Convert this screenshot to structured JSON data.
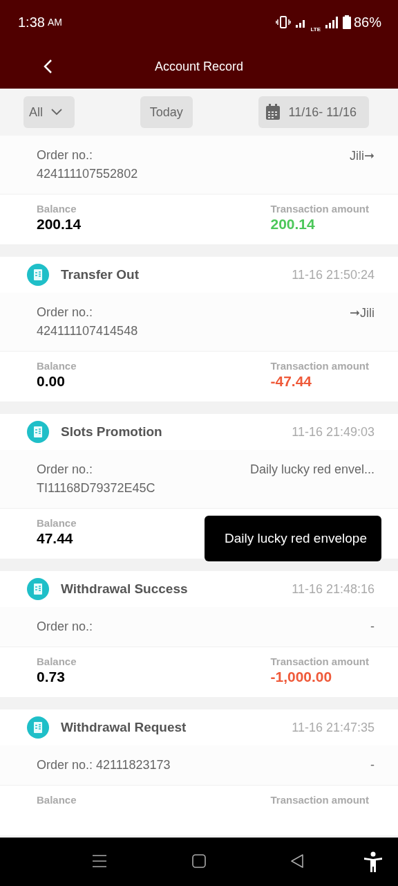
{
  "status_bar": {
    "time": "1:38",
    "meridiem": "AM",
    "network": "LTE",
    "battery": "86%"
  },
  "header": {
    "title": "Account Record"
  },
  "filters": {
    "type": "All",
    "period": "Today",
    "date_range": "11/16- 11/16"
  },
  "records": [
    {
      "order_label": "Order no.:",
      "order_number": "424111107552802",
      "target": "Jili➞",
      "balance_label": "Balance",
      "balance": "200.14",
      "amount_label": "Transaction amount",
      "amount": "200.14",
      "kind": "credit"
    },
    {
      "title": "Transfer Out",
      "time": "11-16 21:50:24",
      "order_label": "Order no.:",
      "order_number": "424111107414548",
      "target": "➞Jili",
      "balance_label": "Balance",
      "balance": "0.00",
      "amount_label": "Transaction amount",
      "amount": "-47.44",
      "kind": "debit"
    },
    {
      "title": "Slots Promotion",
      "time": "11-16 21:49:03",
      "order_label": "Order no.:",
      "order_number": "TI11168D79372E45C",
      "target": "Daily lucky red envel...",
      "balance_label": "Balance",
      "balance": "47.44",
      "kind": "credit"
    },
    {
      "title": "Withdrawal Success",
      "time": "11-16 21:48:16",
      "order_label": "Order no.:",
      "target": "-",
      "balance_label": "Balance",
      "balance": "0.73",
      "amount_label": "Transaction amount",
      "amount": "-1,000.00",
      "kind": "debit"
    },
    {
      "title": "Withdrawal Request",
      "time": "11-16 21:47:35",
      "order_label": "Order no.: 42111823173",
      "target": "-",
      "balance_label": "Balance",
      "amount_label": "Transaction amount",
      "kind": "debit"
    }
  ],
  "tooltip": {
    "text": "Daily lucky red envelope"
  }
}
